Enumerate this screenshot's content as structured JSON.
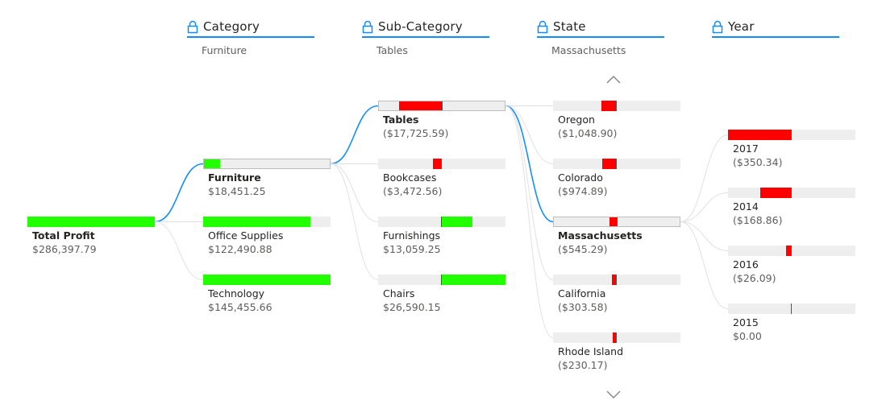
{
  "columns": [
    {
      "title": "Category",
      "selected": "Furniture"
    },
    {
      "title": "Sub-Category",
      "selected": "Tables"
    },
    {
      "title": "State",
      "selected": "Massachusetts"
    },
    {
      "title": "Year",
      "selected": ""
    }
  ],
  "root": {
    "label": "Total Profit",
    "value": "$286,397.79",
    "profit": 286397.79
  },
  "category": [
    {
      "label": "Furniture",
      "value": "$18,451.25",
      "profit": 18451.25,
      "selected": true
    },
    {
      "label": "Office Supplies",
      "value": "$122,490.88",
      "profit": 122490.88,
      "selected": false
    },
    {
      "label": "Technology",
      "value": "$145,455.66",
      "profit": 145455.66,
      "selected": false
    }
  ],
  "subcategory": [
    {
      "label": "Tables",
      "value": "($17,725.59)",
      "profit": -17725.59,
      "selected": true
    },
    {
      "label": "Bookcases",
      "value": "($3,472.56)",
      "profit": -3472.56,
      "selected": false
    },
    {
      "label": "Furnishings",
      "value": "$13,059.25",
      "profit": 13059.25,
      "selected": false
    },
    {
      "label": "Chairs",
      "value": "$26,590.15",
      "profit": 26590.15,
      "selected": false
    }
  ],
  "state": [
    {
      "label": "Oregon",
      "value": "($1,048.90)",
      "profit": -1048.9,
      "selected": false
    },
    {
      "label": "Colorado",
      "value": "($974.89)",
      "profit": -974.89,
      "selected": false
    },
    {
      "label": "Massachusetts",
      "value": "($545.29)",
      "profit": -545.29,
      "selected": true
    },
    {
      "label": "California",
      "value": "($303.58)",
      "profit": -303.58,
      "selected": false
    },
    {
      "label": "Rhode Island",
      "value": "($230.17)",
      "profit": -230.17,
      "selected": false
    }
  ],
  "year": [
    {
      "label": "2017",
      "value": "($350.34)",
      "profit": -350.34,
      "selected": false
    },
    {
      "label": "2014",
      "value": "($168.86)",
      "profit": -168.86,
      "selected": false
    },
    {
      "label": "2016",
      "value": "($26.09)",
      "profit": -26.09,
      "selected": false
    },
    {
      "label": "2015",
      "value": "$0.00",
      "profit": 0,
      "selected": false
    }
  ],
  "colors": {
    "positive": "#22ff00",
    "negative": "#ff0000",
    "accent": "#118dff",
    "connector": "#e1e1e1"
  },
  "icons": {
    "lock": "lock-icon",
    "scroll_up": "chevron-up-icon",
    "scroll_down": "chevron-down-icon"
  }
}
